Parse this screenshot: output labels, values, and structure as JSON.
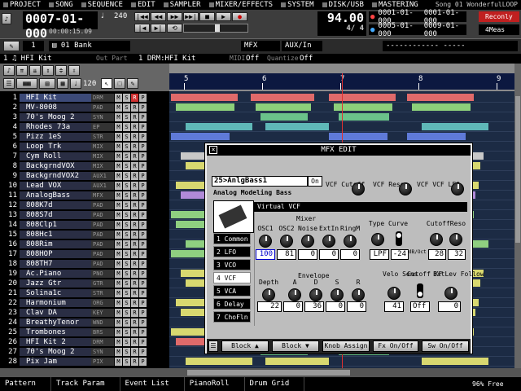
{
  "menu": {
    "items": [
      "PROJECT",
      "SONG",
      "SEQUENCE",
      "EDIT",
      "SAMPLER",
      "MIXER/EFFECTS",
      "SYSTEM",
      "DISK/USB",
      "MASTERING"
    ],
    "song_name": "Song 01 WonderfulLOOP"
  },
  "transport": {
    "position": "0007-01-000",
    "time": "00:00:15.09",
    "tempo_icon": "♩",
    "tempo_small": "240",
    "tempo": "94.00",
    "signature": "4/ 4",
    "locator1_start": "0001-01-000",
    "locator1_end": "0001-01-000",
    "locator2_start": "0005-01-000",
    "locator2_end": "0009-01-000",
    "record_mode": "Reconly",
    "loop_len": "4Meas"
  },
  "infobar": {
    "bank": "01 Bank",
    "bank_num": "1",
    "mfx": "MFX",
    "aux": "AUX/In",
    "dashes": "------------ -----"
  },
  "trackbar": {
    "track": "1 ♫ HFI Kit",
    "out_part_label": "Out Part",
    "out_part": "1 DRM:HFI Kit",
    "midi_label": "MIDI",
    "midi": "Off",
    "quantize_label": "Quantize",
    "quantize": "Off"
  },
  "toolrow": {
    "zoom": "120"
  },
  "ruler": {
    "measures": [
      "5",
      "6",
      "7",
      "8",
      "9"
    ]
  },
  "tracks": [
    {
      "n": "1",
      "name": "HFI Kit",
      "inst": "DRM"
    },
    {
      "n": "2",
      "name": "MV-8008",
      "inst": "PAD"
    },
    {
      "n": "3",
      "name": "70's Moog 2",
      "inst": "SYN"
    },
    {
      "n": "4",
      "name": "Rhodes 73a",
      "inst": "EP"
    },
    {
      "n": "5",
      "name": "Pizz 1eS",
      "inst": "STR"
    },
    {
      "n": "6",
      "name": "Loop Trk",
      "inst": "MIX"
    },
    {
      "n": "7",
      "name": "Cym Roll",
      "inst": "MIX"
    },
    {
      "n": "8",
      "name": "BackgrndVOX",
      "inst": "MIX"
    },
    {
      "n": "9",
      "name": "BackgrndVOX2",
      "inst": "AUX1"
    },
    {
      "n": "10",
      "name": "Lead VOX",
      "inst": "AUX1"
    },
    {
      "n": "11",
      "name": "AnalogBass",
      "inst": "MFX"
    },
    {
      "n": "12",
      "name": "808K7d",
      "inst": "PAD"
    },
    {
      "n": "13",
      "name": "808S7d",
      "inst": "PAD"
    },
    {
      "n": "14",
      "name": "808Clp1",
      "inst": "PAD"
    },
    {
      "n": "15",
      "name": "808Hc1",
      "inst": "PAD"
    },
    {
      "n": "16",
      "name": "808Rim",
      "inst": "PAD"
    },
    {
      "n": "17",
      "name": "808HOP",
      "inst": "PAD"
    },
    {
      "n": "18",
      "name": "808TH7",
      "inst": "PAD"
    },
    {
      "n": "19",
      "name": "Ac.Piano",
      "inst": "PNO"
    },
    {
      "n": "20",
      "name": "Jazz Gtr",
      "inst": "GTR"
    },
    {
      "n": "21",
      "name": "Solina1c",
      "inst": "STR"
    },
    {
      "n": "22",
      "name": "Harmonium",
      "inst": "ORG"
    },
    {
      "n": "23",
      "name": "Clav DA",
      "inst": "KEY"
    },
    {
      "n": "24",
      "name": "BreathyTenor",
      "inst": "WND"
    },
    {
      "n": "25",
      "name": "Trombones",
      "inst": "BRS"
    },
    {
      "n": "26",
      "name": "HFI Kit 2",
      "inst": "DRM"
    },
    {
      "n": "27",
      "name": "70's Moog 2",
      "inst": "SYN"
    },
    {
      "n": "28",
      "name": "Pix Jam",
      "inst": "PIX"
    }
  ],
  "track_buttons": {
    "m": "M",
    "s": "S",
    "r": "R",
    "p": "P"
  },
  "mfx": {
    "title": "MFX EDIT",
    "patch": "25>AnlgBass1",
    "on": "On",
    "patch_name": "Analog Modeling Bass",
    "top_knobs": [
      "VCF Cutoff",
      "VCF Reso",
      "VCF VCF LFO"
    ],
    "section": "Virtual VCF",
    "mixer_label": "Mixer",
    "mixer": [
      {
        "label": "OSC1",
        "value": "100"
      },
      {
        "label": "OSC2",
        "value": "81"
      },
      {
        "label": "Noise",
        "value": "0"
      },
      {
        "label": "ExtIn",
        "value": "0"
      },
      {
        "label": "RingM",
        "value": "0"
      }
    ],
    "type_curve": "Type Curve",
    "type": "LPF",
    "curve": "-24",
    "dboct": "dB/Oct",
    "cutoff_reso": "CutoffReso",
    "cutoff": "28",
    "reso": "32",
    "envelope_label": "Envelope",
    "envelope": [
      {
        "label": "Depth",
        "value": "22"
      },
      {
        "label": "A",
        "value": "0"
      },
      {
        "label": "D",
        "value": "36"
      },
      {
        "label": "S",
        "value": "0"
      },
      {
        "label": "R",
        "value": "0"
      }
    ],
    "velo": {
      "label": "Velo Sens",
      "value": "41"
    },
    "kf": {
      "label": "Cutoff KF",
      "value": "Off"
    },
    "extlev": {
      "label": "ExtLev Follow",
      "value": "0"
    },
    "blocks": [
      "1 Common",
      "2 LFO",
      "3 VCO",
      "4 VCF",
      "5 VCA",
      "6 Delay",
      "7 ChoFln"
    ],
    "buttons": [
      "Block ▲",
      "Block ▼",
      "Knob Assign",
      "Fx On/Off",
      "Sw On/Off"
    ]
  },
  "statusbar": {
    "tabs": [
      "Pattern",
      "Track Param",
      "Event List",
      "PianoRoll",
      "Drum Grid"
    ],
    "free": "96% Free"
  }
}
